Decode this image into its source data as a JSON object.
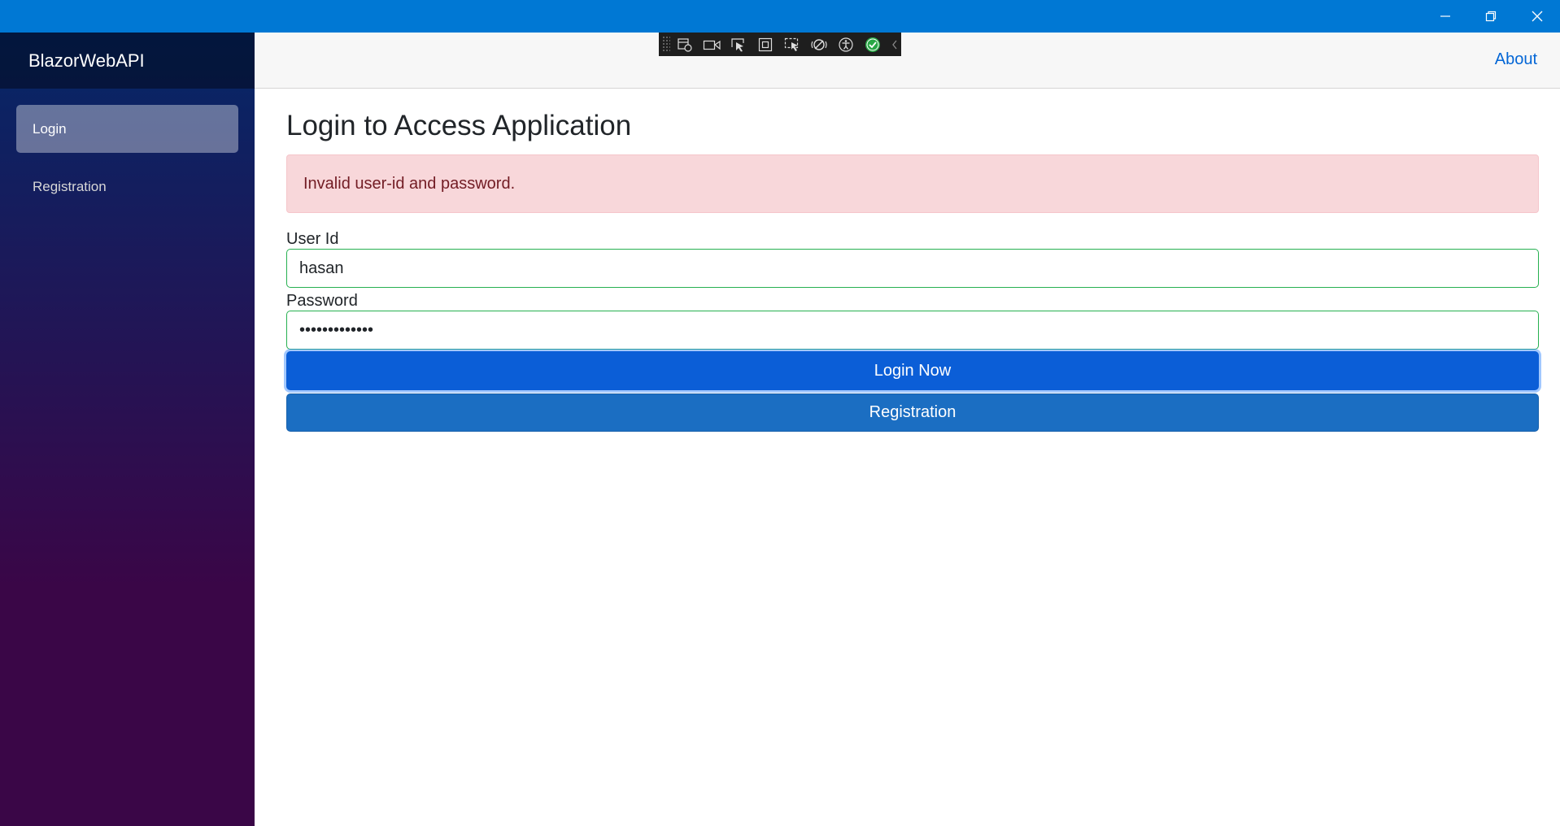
{
  "window": {
    "title_bar_color": "#0078d4",
    "controls": [
      "minimize-icon",
      "restore-icon",
      "close-icon"
    ]
  },
  "sidebar": {
    "brand": "BlazorWebAPI",
    "items": [
      {
        "label": "Login",
        "active": true
      },
      {
        "label": "Registration",
        "active": false
      }
    ]
  },
  "top_row": {
    "about_label": "About"
  },
  "dev_toolbar": {
    "icons": [
      "live-visual-tree-icon",
      "record-icon",
      "select-element-icon",
      "display-layout-adorners-icon",
      "track-focus-icon",
      "binding-failures-icon",
      "accessibility-icon",
      "check-icon",
      "collapse-icon"
    ]
  },
  "main": {
    "title": "Login to Access Application",
    "alert": "Invalid user-id and password.",
    "user_id_label": "User Id",
    "user_id_value": "hasan",
    "password_label": "Password",
    "password_value": "•••••••••••••",
    "login_button": "Login Now",
    "registration_button": "Registration"
  },
  "colors": {
    "primary": "#0b5ed7",
    "secondary": "#1b6ec2",
    "alert_bg": "#f8d7da",
    "alert_text": "#721c24",
    "valid_border": "#26b050",
    "link": "#0366d6"
  }
}
